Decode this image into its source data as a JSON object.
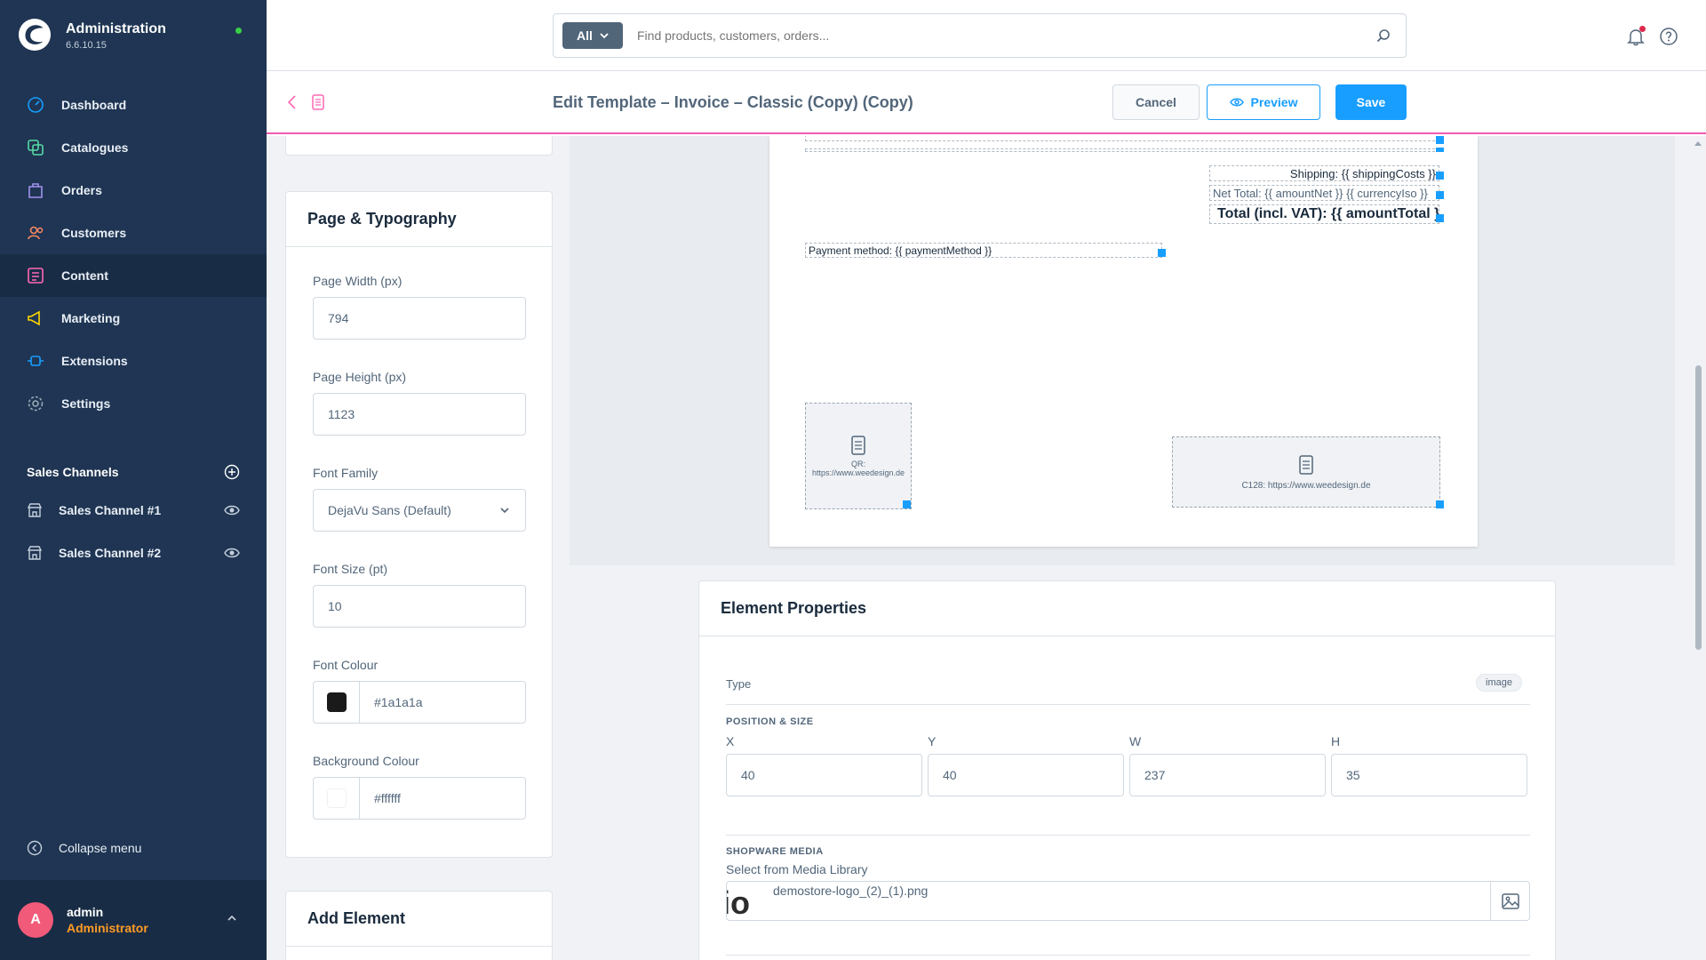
{
  "app": {
    "title": "Administration",
    "version": "6.6.10.15",
    "status_color": "#37d046"
  },
  "nav": {
    "items": [
      {
        "label": "Dashboard",
        "icon": "dashboard-icon",
        "color": "#189eff"
      },
      {
        "label": "Catalogues",
        "icon": "catalogues-icon",
        "color": "#57d9a3"
      },
      {
        "label": "Orders",
        "icon": "orders-icon",
        "color": "#a092f0"
      },
      {
        "label": "Customers",
        "icon": "customers-icon",
        "color": "#f88962"
      },
      {
        "label": "Content",
        "icon": "content-icon",
        "color": "#ff68b4",
        "active": true
      },
      {
        "label": "Marketing",
        "icon": "marketing-icon",
        "color": "#ffd700"
      },
      {
        "label": "Extensions",
        "icon": "extensions-icon",
        "color": "#189eff"
      },
      {
        "label": "Settings",
        "icon": "settings-icon",
        "color": "#9aa8b5"
      }
    ]
  },
  "sales_channels": {
    "header": "Sales Channels",
    "items": [
      {
        "label": "Sales Channel #1"
      },
      {
        "label": "Sales Channel #2"
      }
    ]
  },
  "collapse_label": "Collapse menu",
  "user": {
    "initial": "A",
    "name": "admin",
    "role": "Administrator",
    "avatar_color": "#f25a79"
  },
  "search": {
    "filter_label": "All",
    "placeholder": "Find products, customers, orders..."
  },
  "smartbar": {
    "title": "Edit Template – Invoice – Classic (Copy) (Copy)",
    "cancel_label": "Cancel",
    "preview_label": "Preview",
    "save_label": "Save"
  },
  "page_typography": {
    "title": "Page & Typography",
    "page_width_label": "Page Width (px)",
    "page_width": "794",
    "page_height_label": "Page Height (px)",
    "page_height": "1123",
    "font_family_label": "Font Family",
    "font_family": "DejaVu Sans (Default)",
    "font_size_label": "Font Size (pt)",
    "font_size": "10",
    "font_colour_label": "Font Colour",
    "font_colour": "#1a1a1a",
    "bg_colour_label": "Background Colour",
    "bg_colour": "#ffffff"
  },
  "add_element": {
    "title": "Add Element"
  },
  "canvas": {
    "shipping": "Shipping: {{ shippingCosts }}",
    "net_total": "Net Total: {{ amountNet }} {{ currencyIso }}",
    "total": "Total (incl. VAT): {{ amountTotal }}",
    "payment": "Payment method: {{ paymentMethod }}",
    "qr_label": "QR:",
    "qr_url": "https://www.weedesign.de",
    "c128": "C128: https://www.weedesign.de"
  },
  "element_properties": {
    "title": "Element Properties",
    "type_label": "Type",
    "type_value": "image",
    "position_section": "POSITION & SIZE",
    "x_label": "X",
    "x": "40",
    "y_label": "Y",
    "y": "40",
    "w_label": "W",
    "w": "237",
    "h_label": "H",
    "h": "35",
    "media_section": "SHOPWARE MEDIA",
    "media_label": "Select from Media Library",
    "media_file": "demostore-logo_(2)_(1).png",
    "media_thumb_text": "io"
  }
}
